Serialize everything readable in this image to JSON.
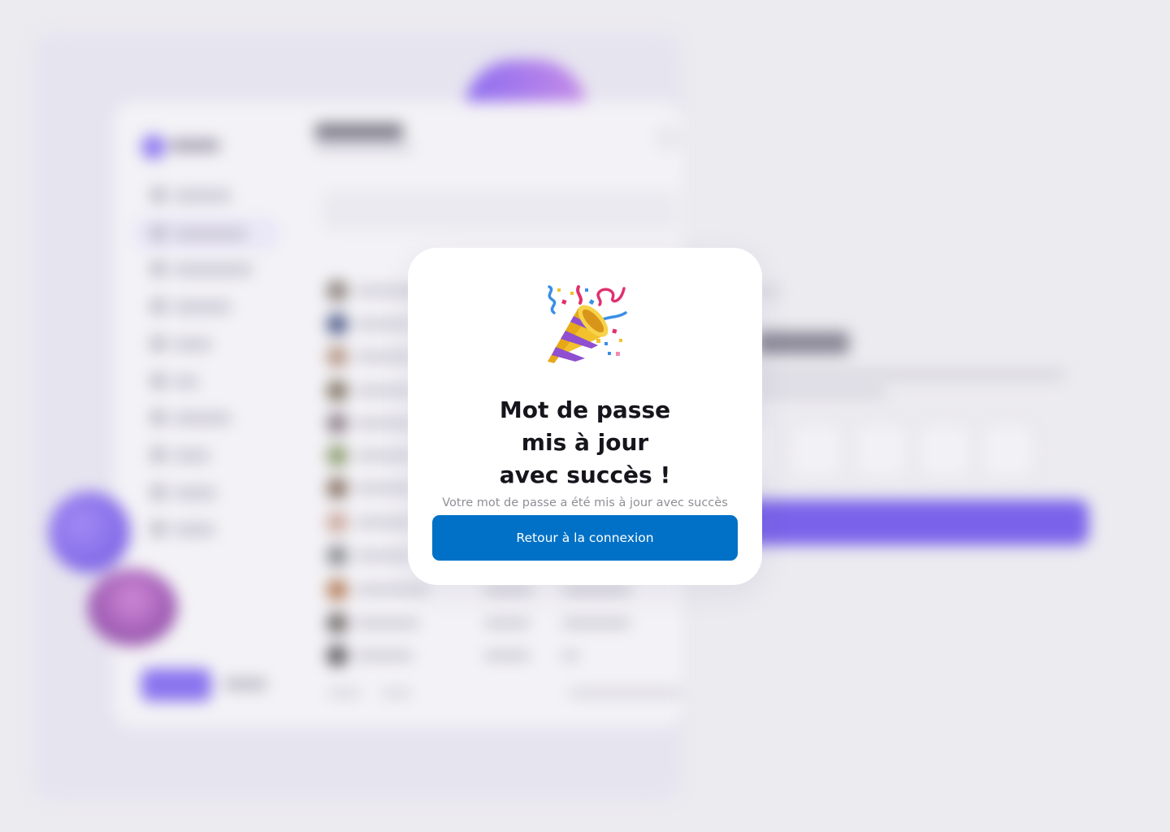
{
  "modal": {
    "title_lines": [
      "Mot de passe",
      "mis à jour",
      "avec succès !"
    ],
    "subtitle": "Votre mot de passe a été mis à jour avec succès",
    "button_label": "Retour à la connexion",
    "icon": "party-popper-icon"
  },
  "colors": {
    "button": "#0071c6",
    "title": "#16151c",
    "subtitle": "#8f8e96",
    "modal_bg": "#ffffff",
    "page_bg": "#ecebf0",
    "accent_purple": "#7a63ea"
  }
}
